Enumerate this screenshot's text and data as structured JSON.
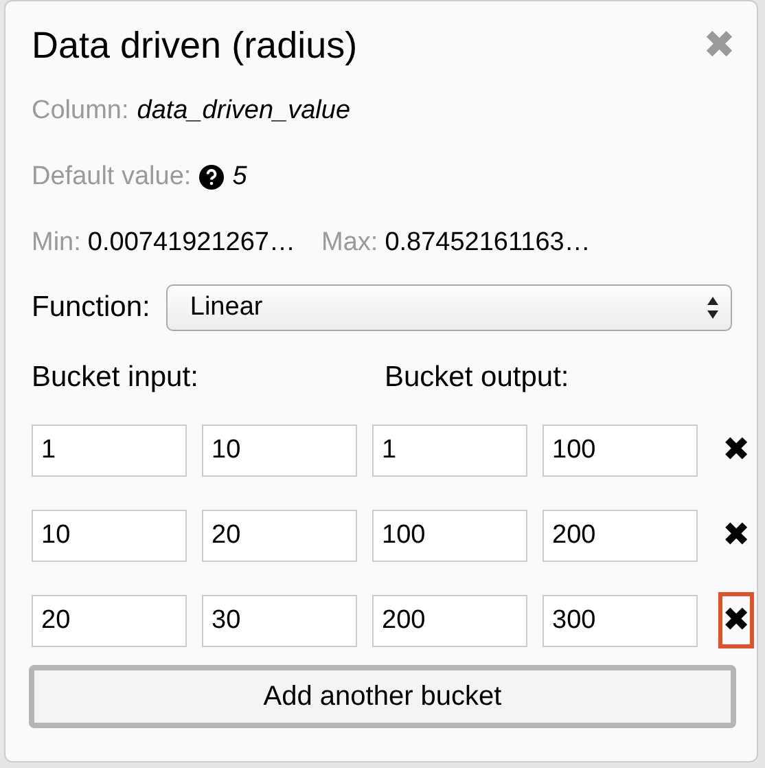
{
  "dialog": {
    "title": "Data driven (radius)",
    "close": "✖"
  },
  "column": {
    "label": "Column:",
    "value": "data_driven_value"
  },
  "default_value": {
    "label": "Default value:",
    "value": "5"
  },
  "min": {
    "label": "Min:",
    "value": "0.00741921267…"
  },
  "max": {
    "label": "Max:",
    "value": "0.87452161163…"
  },
  "function": {
    "label": "Function:",
    "value": "Linear"
  },
  "bucket_headers": [
    "Bucket input:",
    "Bucket output:"
  ],
  "buckets": [
    {
      "values": [
        "1",
        "10",
        "1",
        "100"
      ],
      "remove": "✖",
      "highlighted": false
    },
    {
      "values": [
        "10",
        "20",
        "100",
        "200"
      ],
      "remove": "✖",
      "highlighted": false
    },
    {
      "values": [
        "20",
        "30",
        "200",
        "300"
      ],
      "remove": "✖",
      "highlighted": true
    }
  ],
  "add_button": "Add another bucket"
}
